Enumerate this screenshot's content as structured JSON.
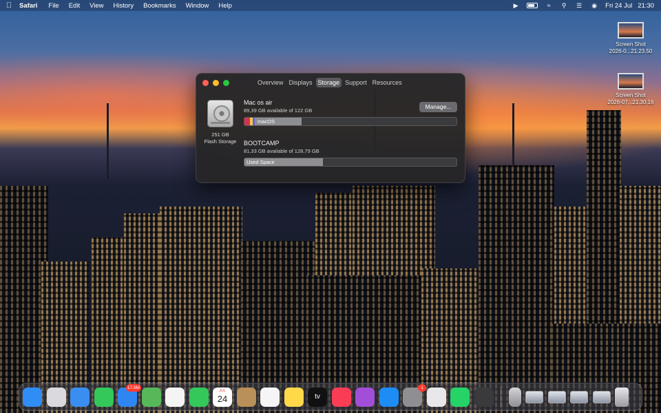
{
  "menubar": {
    "app_name": "Safari",
    "items": [
      "File",
      "Edit",
      "View",
      "History",
      "Bookmarks",
      "Window",
      "Help"
    ],
    "date": "Fri 24 Jul",
    "time": "21:30",
    "status_icons": [
      "play-icon",
      "battery-icon",
      "wifi-icon",
      "search-icon",
      "control-center-icon",
      "siri-icon"
    ]
  },
  "desktop": {
    "items": [
      {
        "line1": "Screen Shot",
        "line2": "2026-0...21.23.50"
      },
      {
        "line1": "Screen Shot",
        "line2": "2026-07...21.30.16"
      }
    ]
  },
  "window": {
    "tabs": [
      "Overview",
      "Displays",
      "Storage",
      "Support",
      "Resources"
    ],
    "active_tab": "Storage",
    "disk": {
      "size": "251 GB",
      "type": "Flash Storage"
    },
    "manage_label": "Manage...",
    "volumes": [
      {
        "name": "Mac os air",
        "available": "89,39 GB available of 122 GB",
        "bar_label": "macOS",
        "used_fraction": 0.27
      },
      {
        "name": "BOOTCAMP",
        "available": "81,33 GB available of 128,79 GB",
        "bar_label": "Used Space",
        "used_fraction": 0.37
      }
    ]
  },
  "dock": {
    "apps": [
      {
        "name": "Finder",
        "icon": "finder-icon",
        "color": "#2f8df5"
      },
      {
        "name": "Launchpad",
        "icon": "launchpad-icon",
        "color": "#d9d9de"
      },
      {
        "name": "Safari",
        "icon": "safari-icon",
        "color": "#3a8ef0"
      },
      {
        "name": "Messages",
        "icon": "messages-icon",
        "color": "#34c759"
      },
      {
        "name": "Mail",
        "icon": "mail-icon",
        "color": "#2f86f2",
        "badge": "17.6M"
      },
      {
        "name": "Maps",
        "icon": "maps-icon",
        "color": "#57b85a"
      },
      {
        "name": "Photos",
        "icon": "photos-icon",
        "color": "#f4f4f4"
      },
      {
        "name": "FaceTime",
        "icon": "facetime-icon",
        "color": "#34c759"
      },
      {
        "name": "Calendar",
        "icon": "calendar-icon",
        "color": "#ffffff",
        "month": "JUL",
        "day": "24"
      },
      {
        "name": "Contacts",
        "icon": "contacts-icon",
        "color": "#b9905a"
      },
      {
        "name": "Reminders",
        "icon": "reminders-icon",
        "color": "#f5f5f5"
      },
      {
        "name": "Notes",
        "icon": "notes-icon",
        "color": "#ffd94a"
      },
      {
        "name": "TV",
        "icon": "tv-icon",
        "color": "#111111",
        "label": "tv"
      },
      {
        "name": "Music",
        "icon": "music-icon",
        "color": "#fa3d55"
      },
      {
        "name": "Podcasts",
        "icon": "podcasts-icon",
        "color": "#a24ed8"
      },
      {
        "name": "App Store",
        "icon": "app-store-icon",
        "color": "#1d8cf4"
      },
      {
        "name": "System Preferences",
        "icon": "settings-icon",
        "color": "#8e8e93",
        "badge": "1"
      },
      {
        "name": "Preview",
        "icon": "preview-icon",
        "color": "#e8e8ea"
      },
      {
        "name": "WhatsApp",
        "icon": "whatsapp-icon",
        "color": "#25d366"
      },
      {
        "name": "Calculator",
        "icon": "calculator-icon",
        "color": "#3a3a3c"
      }
    ],
    "right_items": [
      "disk-utility-icon",
      "minimized-window-1",
      "minimized-window-2",
      "minimized-window-3",
      "minimized-window-4",
      "trash-icon"
    ]
  }
}
